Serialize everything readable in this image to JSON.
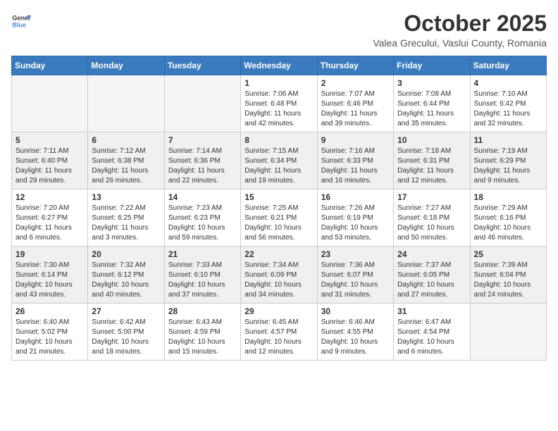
{
  "header": {
    "logo_general": "General",
    "logo_blue": "Blue",
    "title": "October 2025",
    "subtitle": "Valea Grecului, Vaslui County, Romania"
  },
  "days_of_week": [
    "Sunday",
    "Monday",
    "Tuesday",
    "Wednesday",
    "Thursday",
    "Friday",
    "Saturday"
  ],
  "weeks": [
    [
      {
        "day": "",
        "info": ""
      },
      {
        "day": "",
        "info": ""
      },
      {
        "day": "",
        "info": ""
      },
      {
        "day": "1",
        "info": "Sunrise: 7:06 AM\nSunset: 6:48 PM\nDaylight: 11 hours and 42 minutes."
      },
      {
        "day": "2",
        "info": "Sunrise: 7:07 AM\nSunset: 6:46 PM\nDaylight: 11 hours and 39 minutes."
      },
      {
        "day": "3",
        "info": "Sunrise: 7:08 AM\nSunset: 6:44 PM\nDaylight: 11 hours and 35 minutes."
      },
      {
        "day": "4",
        "info": "Sunrise: 7:10 AM\nSunset: 6:42 PM\nDaylight: 11 hours and 32 minutes."
      }
    ],
    [
      {
        "day": "5",
        "info": "Sunrise: 7:11 AM\nSunset: 6:40 PM\nDaylight: 11 hours and 29 minutes."
      },
      {
        "day": "6",
        "info": "Sunrise: 7:12 AM\nSunset: 6:38 PM\nDaylight: 11 hours and 26 minutes."
      },
      {
        "day": "7",
        "info": "Sunrise: 7:14 AM\nSunset: 6:36 PM\nDaylight: 11 hours and 22 minutes."
      },
      {
        "day": "8",
        "info": "Sunrise: 7:15 AM\nSunset: 6:34 PM\nDaylight: 11 hours and 19 minutes."
      },
      {
        "day": "9",
        "info": "Sunrise: 7:16 AM\nSunset: 6:33 PM\nDaylight: 11 hours and 16 minutes."
      },
      {
        "day": "10",
        "info": "Sunrise: 7:18 AM\nSunset: 6:31 PM\nDaylight: 11 hours and 12 minutes."
      },
      {
        "day": "11",
        "info": "Sunrise: 7:19 AM\nSunset: 6:29 PM\nDaylight: 11 hours and 9 minutes."
      }
    ],
    [
      {
        "day": "12",
        "info": "Sunrise: 7:20 AM\nSunset: 6:27 PM\nDaylight: 11 hours and 6 minutes."
      },
      {
        "day": "13",
        "info": "Sunrise: 7:22 AM\nSunset: 6:25 PM\nDaylight: 11 hours and 3 minutes."
      },
      {
        "day": "14",
        "info": "Sunrise: 7:23 AM\nSunset: 6:23 PM\nDaylight: 10 hours and 59 minutes."
      },
      {
        "day": "15",
        "info": "Sunrise: 7:25 AM\nSunset: 6:21 PM\nDaylight: 10 hours and 56 minutes."
      },
      {
        "day": "16",
        "info": "Sunrise: 7:26 AM\nSunset: 6:19 PM\nDaylight: 10 hours and 53 minutes."
      },
      {
        "day": "17",
        "info": "Sunrise: 7:27 AM\nSunset: 6:18 PM\nDaylight: 10 hours and 50 minutes."
      },
      {
        "day": "18",
        "info": "Sunrise: 7:29 AM\nSunset: 6:16 PM\nDaylight: 10 hours and 46 minutes."
      }
    ],
    [
      {
        "day": "19",
        "info": "Sunrise: 7:30 AM\nSunset: 6:14 PM\nDaylight: 10 hours and 43 minutes."
      },
      {
        "day": "20",
        "info": "Sunrise: 7:32 AM\nSunset: 6:12 PM\nDaylight: 10 hours and 40 minutes."
      },
      {
        "day": "21",
        "info": "Sunrise: 7:33 AM\nSunset: 6:10 PM\nDaylight: 10 hours and 37 minutes."
      },
      {
        "day": "22",
        "info": "Sunrise: 7:34 AM\nSunset: 6:09 PM\nDaylight: 10 hours and 34 minutes."
      },
      {
        "day": "23",
        "info": "Sunrise: 7:36 AM\nSunset: 6:07 PM\nDaylight: 10 hours and 31 minutes."
      },
      {
        "day": "24",
        "info": "Sunrise: 7:37 AM\nSunset: 6:05 PM\nDaylight: 10 hours and 27 minutes."
      },
      {
        "day": "25",
        "info": "Sunrise: 7:39 AM\nSunset: 6:04 PM\nDaylight: 10 hours and 24 minutes."
      }
    ],
    [
      {
        "day": "26",
        "info": "Sunrise: 6:40 AM\nSunset: 5:02 PM\nDaylight: 10 hours and 21 minutes."
      },
      {
        "day": "27",
        "info": "Sunrise: 6:42 AM\nSunset: 5:00 PM\nDaylight: 10 hours and 18 minutes."
      },
      {
        "day": "28",
        "info": "Sunrise: 6:43 AM\nSunset: 4:59 PM\nDaylight: 10 hours and 15 minutes."
      },
      {
        "day": "29",
        "info": "Sunrise: 6:45 AM\nSunset: 4:57 PM\nDaylight: 10 hours and 12 minutes."
      },
      {
        "day": "30",
        "info": "Sunrise: 6:46 AM\nSunset: 4:55 PM\nDaylight: 10 hours and 9 minutes."
      },
      {
        "day": "31",
        "info": "Sunrise: 6:47 AM\nSunset: 4:54 PM\nDaylight: 10 hours and 6 minutes."
      },
      {
        "day": "",
        "info": ""
      }
    ]
  ]
}
